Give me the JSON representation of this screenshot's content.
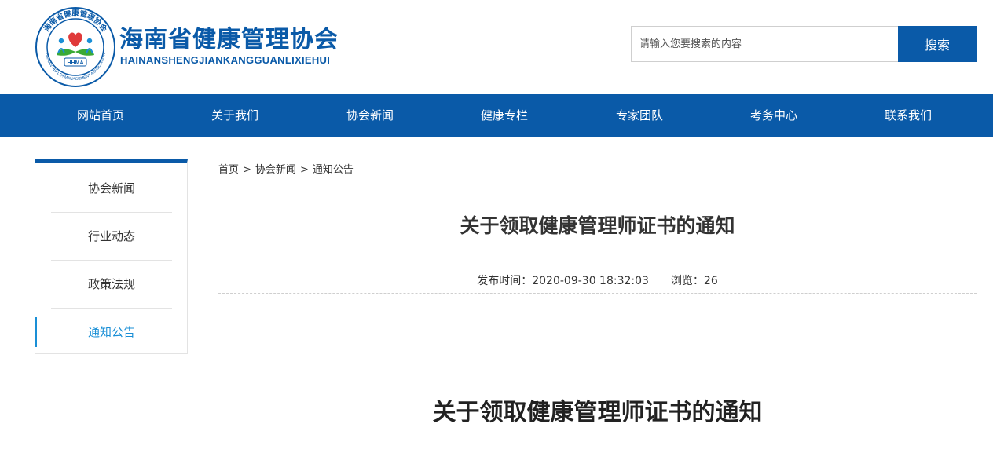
{
  "header": {
    "logo": {
      "ring_text": "海南省健康管理协会",
      "ring_text_en": "HAINAN HEALTH MANAGEMENT ASSOCIATION",
      "badge_text": "HHMA",
      "icon": "heart-hands-emblem-icon",
      "colors": {
        "ring": "#0a5aa8",
        "heart": "#e03a3a",
        "leaves": "#3aaa35"
      }
    },
    "title_cn": "海南省健康管理协会",
    "title_en": "HAINANSHENGJIANKANGGUANLIXIEHUI",
    "search": {
      "placeholder": "请输入您要搜索的内容",
      "value": "",
      "button_label": "搜索"
    }
  },
  "nav": {
    "items": [
      {
        "label": "网站首页"
      },
      {
        "label": "关于我们"
      },
      {
        "label": "协会新闻"
      },
      {
        "label": "健康专栏"
      },
      {
        "label": "专家团队"
      },
      {
        "label": "考务中心"
      },
      {
        "label": "联系我们"
      }
    ]
  },
  "sidebar": {
    "items": [
      {
        "label": "协会新闻"
      },
      {
        "label": "行业动态"
      },
      {
        "label": "政策法规"
      },
      {
        "label": "通知公告",
        "active": true
      }
    ]
  },
  "breadcrumb": {
    "items": [
      {
        "label": "首页"
      },
      {
        "label": "协会新闻"
      },
      {
        "label": "通知公告"
      }
    ],
    "separator": ">"
  },
  "article": {
    "title": "关于领取健康管理师证书的通知",
    "published": "发布时间：2020-09-30 18:32:03",
    "views": "浏览：26",
    "content_heading": "关于领取健康管理师证书的通知"
  },
  "colors": {
    "primary": "#0a5aa8",
    "active": "#1a8fd6"
  }
}
